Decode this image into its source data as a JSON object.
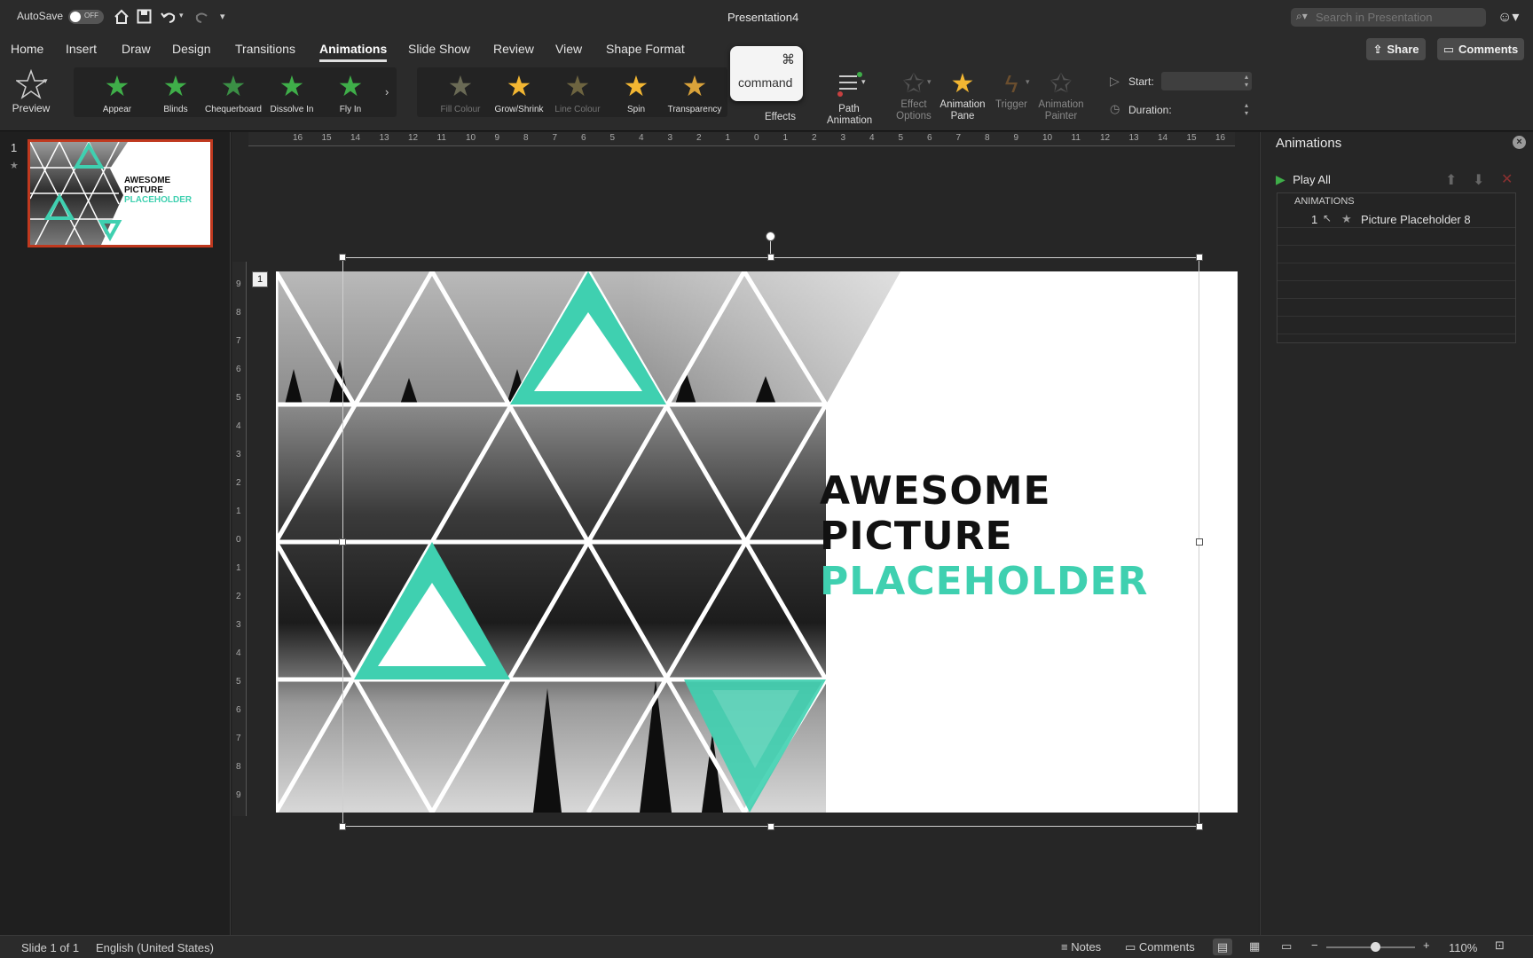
{
  "titlebar": {
    "autosave_label": "AutoSave",
    "autosave_state": "OFF",
    "title": "Presentation4",
    "search_placeholder": "Search in Presentation"
  },
  "tabs": [
    "Home",
    "Insert",
    "Draw",
    "Design",
    "Transitions",
    "Animations",
    "Slide Show",
    "Review",
    "View",
    "Shape Format"
  ],
  "active_tab": "Animations",
  "header_buttons": {
    "share": "Share",
    "comments": "Comments"
  },
  "ribbon": {
    "preview": "Preview",
    "entrance_effects": [
      "Appear",
      "Blinds",
      "Chequerboard",
      "Dissolve In",
      "Fly In"
    ],
    "emphasis_effects": [
      "Fill Colour",
      "Grow/Shrink",
      "Line Colour",
      "Spin",
      "Transparency"
    ],
    "keyboard_hint": {
      "symbol": "⌘",
      "label": "command"
    },
    "effects_label": "Effects",
    "path_animation": [
      "Path",
      "Animation"
    ],
    "effect_options": [
      "Effect",
      "Options"
    ],
    "animation_pane": [
      "Animation",
      "Pane"
    ],
    "trigger": "Trigger",
    "animation_painter": [
      "Animation",
      "Painter"
    ],
    "start_label": "Start:",
    "duration_label": "Duration:"
  },
  "thumbnails": [
    {
      "number": "1"
    }
  ],
  "thumbnail_text": {
    "line1": "AWESOME",
    "line2": "PICTURE",
    "line3": "PLACEHOLDER"
  },
  "slide": {
    "title_line1": "AWESOME",
    "title_line2": "PICTURE",
    "title_line3": "PLACEHOLDER",
    "anim_tag": "1",
    "accent_color": "#3fd0b0"
  },
  "animations_pane": {
    "title": "Animations",
    "play_all": "Play All",
    "section": "ANIMATIONS",
    "items": [
      {
        "order": "1",
        "name": "Picture Placeholder 8"
      }
    ]
  },
  "status": {
    "slide_info": "Slide 1 of 1",
    "language": "English (United States)",
    "notes": "Notes",
    "comments": "Comments",
    "zoom": "110%",
    "zoom_fraction": 0.55
  }
}
